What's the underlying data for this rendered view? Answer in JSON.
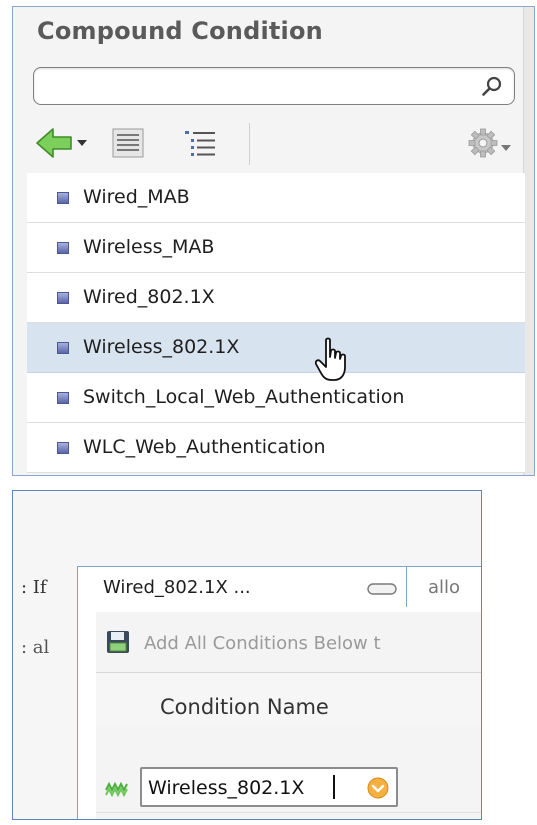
{
  "compound_panel": {
    "title": "Compound Condition",
    "search": {
      "value": "",
      "placeholder": ""
    },
    "toolbar": {
      "icons": [
        "back-arrow-icon",
        "list-view-icon",
        "tree-view-icon",
        "gear-icon"
      ]
    },
    "items": [
      {
        "label": "Wired_MAB",
        "selected": false
      },
      {
        "label": "Wireless_MAB",
        "selected": false
      },
      {
        "label": "Wired_802.1X",
        "selected": false
      },
      {
        "label": "Wireless_802.1X",
        "selected": true
      },
      {
        "label": "Switch_Local_Web_Authentication",
        "selected": false
      },
      {
        "label": "WLC_Web_Authentication",
        "selected": false
      }
    ]
  },
  "rule_editor": {
    "side_labels": {
      "if": ": If",
      "al": ":  al"
    },
    "dialog": {
      "title": "Wired_802.1X ...",
      "next_tab": "allo",
      "add_all_label": "Add All Conditions Below t",
      "condition_name_header": "Condition Name",
      "condition_value": "Wireless_802.1X"
    }
  },
  "colors": {
    "selection": "#d7e3ef",
    "panel_border": "#8aa6cc",
    "toolbar_green": "#5bb14a",
    "dropdown_orange": "#f0a030"
  }
}
